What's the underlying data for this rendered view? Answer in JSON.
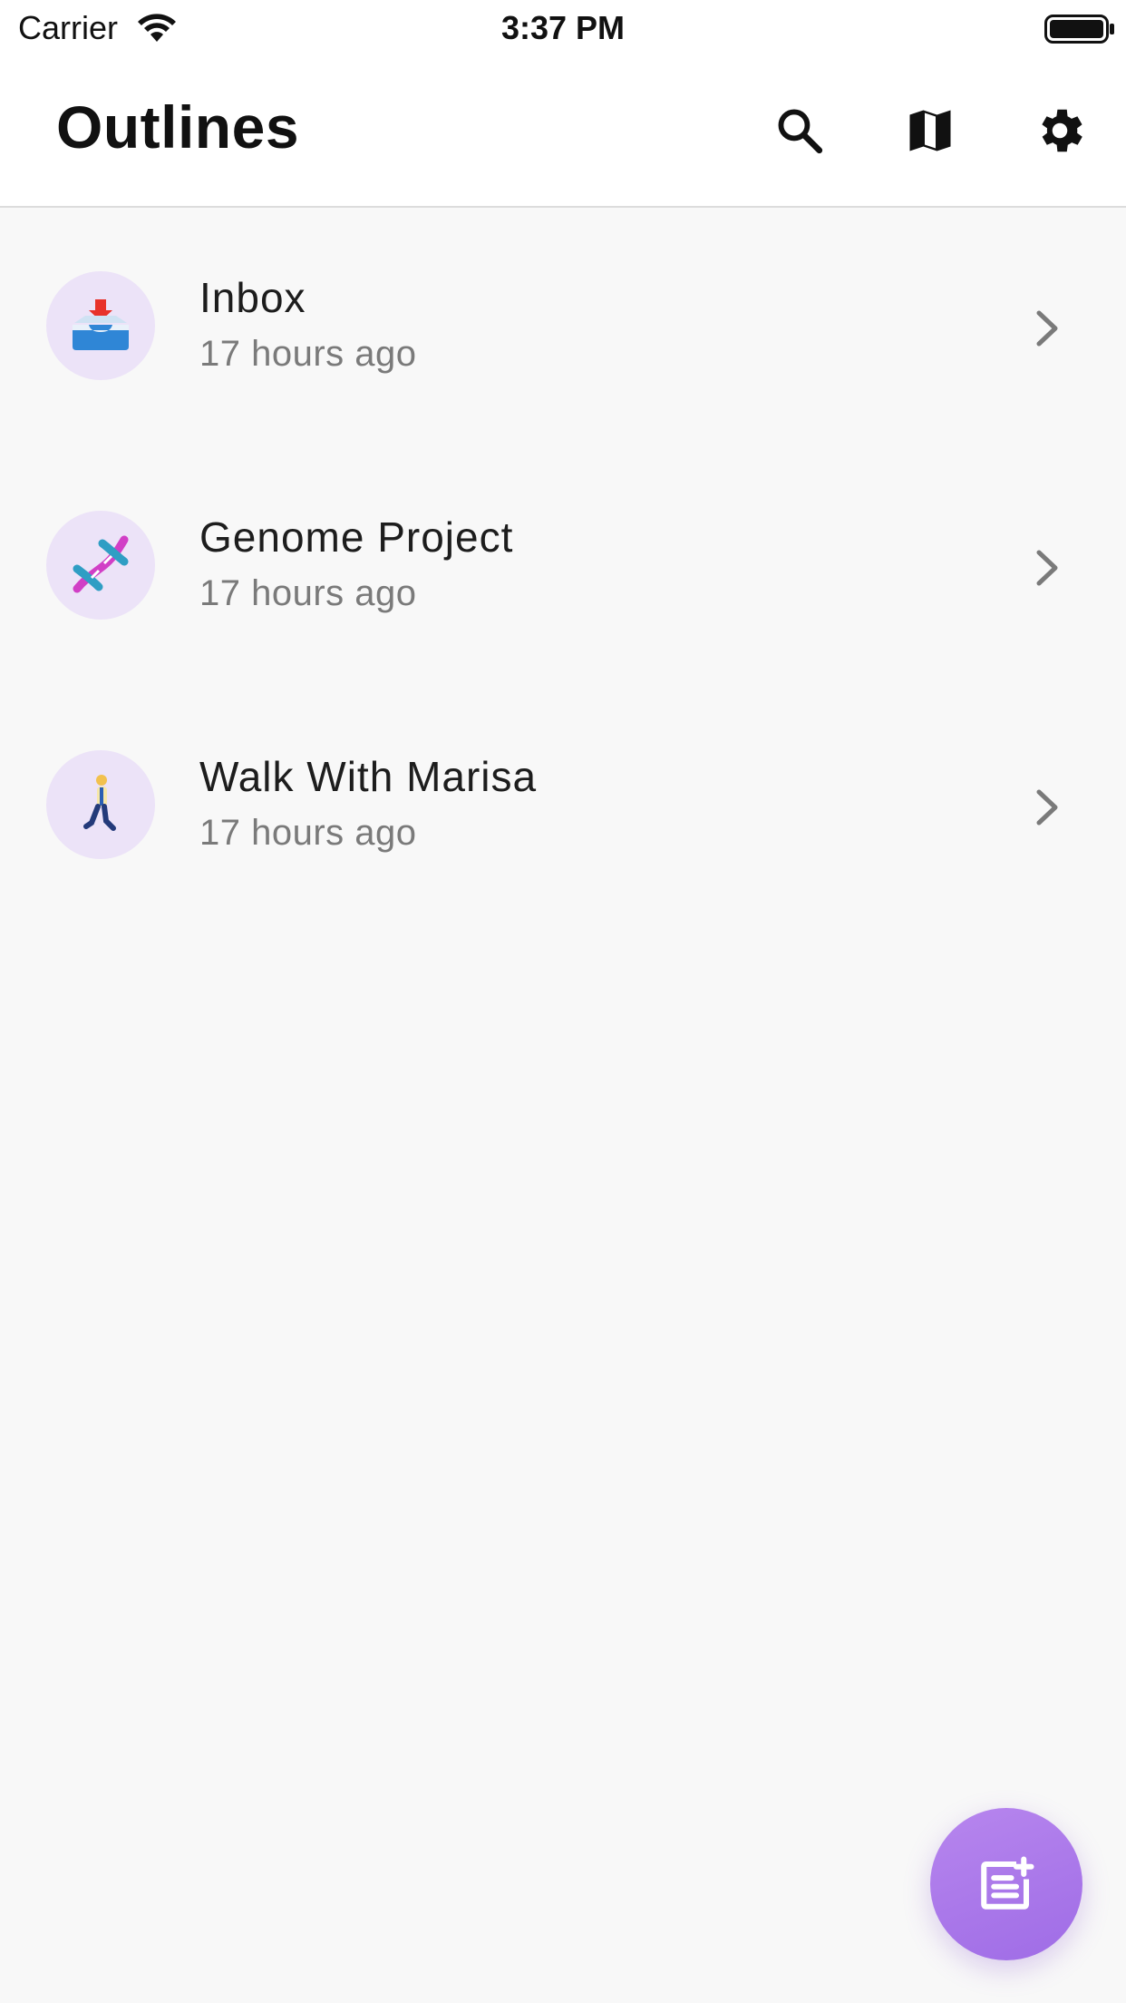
{
  "status_bar": {
    "carrier": "Carrier",
    "time": "3:37 PM"
  },
  "header": {
    "title": "Outlines",
    "icons": [
      "search-icon",
      "map-icon",
      "gear-icon"
    ]
  },
  "outlines": [
    {
      "title": "Inbox",
      "subtitle": "17 hours ago",
      "icon": "inbox-tray-icon"
    },
    {
      "title": "Genome Project",
      "subtitle": "17 hours ago",
      "icon": "dna-icon"
    },
    {
      "title": "Walk With Marisa",
      "subtitle": "17 hours ago",
      "icon": "person-walking-icon"
    }
  ],
  "fab": {
    "icon": "new-note-icon"
  },
  "colors": {
    "accent": "#a77aea",
    "avatar_bg": "#ece3f8",
    "background": "#f8f8f8",
    "secondary_text": "#7a7a7a"
  }
}
